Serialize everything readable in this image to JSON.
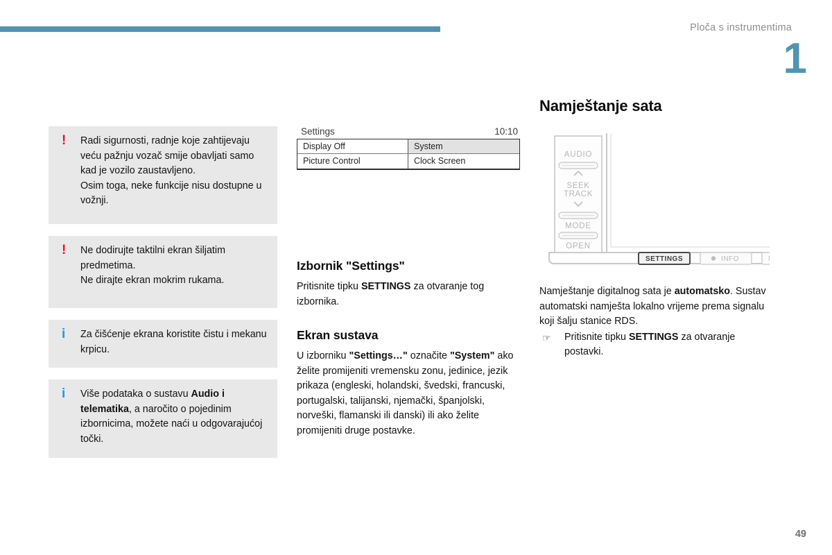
{
  "header": {
    "title": "Ploča s instrumentima",
    "chapter_number": "1",
    "bar_color": "#4f95b2"
  },
  "page_number": "49",
  "left_column": {
    "callouts": [
      {
        "icon": "warning-icon",
        "icon_glyph": "!",
        "icon_color": "#e8112d",
        "text": "Radi sigurnosti, radnje koje zahtijevaju veću pažnju vozač smije obavljati samo kad je vozilo zaustavljeno.",
        "text2": "Osim toga, neke funkcije nisu dostupne u vožnji."
      },
      {
        "icon": "warning-icon",
        "icon_glyph": "!",
        "icon_color": "#e8112d",
        "text": "Ne dodirujte taktilni ekran šiljatim predmetima.",
        "text2": "Ne dirajte ekran mokrim rukama."
      },
      {
        "icon": "info-icon",
        "icon_glyph": "i",
        "icon_color": "#1e9ad6",
        "text": "Za čišćenje ekrana koristite čistu i mekanu krpicu.",
        "text2": ""
      },
      {
        "icon": "info-icon",
        "icon_glyph": "i",
        "icon_color": "#1e9ad6",
        "text_pre": "Više podataka o sustavu ",
        "text_bold": "Audio i telematika",
        "text_post": ", a naročito o pojedinim izbornicima, možete naći u odgovarajućoj točki."
      }
    ]
  },
  "middle_column": {
    "settings_screen": {
      "title": "Settings",
      "time": "10:10",
      "rows": [
        [
          "Display Off",
          "System"
        ],
        [
          "Picture Control",
          "Clock Screen"
        ]
      ],
      "selected_cell": "System"
    },
    "section_settings": {
      "heading": "Izbornik \"Settings\"",
      "text_pre": "Pritisnite tipku ",
      "text_bold": "SETTINGS",
      "text_post": " za otvaranje tog izbornika."
    },
    "section_ekran": {
      "heading": "Ekran sustava",
      "text_pre": "U izborniku ",
      "text_bold1": "\"Settings…\"",
      "text_mid": " označite ",
      "text_bold2": "\"System\"",
      "text_post": " ako želite promijeniti vremensku zonu, jedinice, jezik prikaza (engleski, holandski, švedski, francuski, portugalski, talijanski, njemački, španjolski, norveški, flamanski ili danski) ili ako želite promijeniti druge postavke."
    }
  },
  "right_column": {
    "heading": "Namještanje sata",
    "device": {
      "side_buttons": [
        "AUDIO",
        "SEEK TRACK",
        "MODE",
        "OPEN"
      ],
      "seek_up_icon": "chevron-up-icon",
      "seek_down_icon": "chevron-down-icon",
      "bottom_buttons": [
        "SETTINGS",
        "INFO"
      ],
      "highlighted_button": "SETTINGS"
    },
    "text_pre": "Namještanje digitalnog sata je ",
    "text_bold": "automatsko",
    "text_post": ". Sustav automatski namješta lokalno vrijeme prema signalu koji šalju stanice RDS.",
    "bullet": {
      "glyph": "☞",
      "text_pre": "Pritisnite tipku ",
      "text_bold": "SETTINGS",
      "text_post": " za otvaranje postavki."
    }
  }
}
